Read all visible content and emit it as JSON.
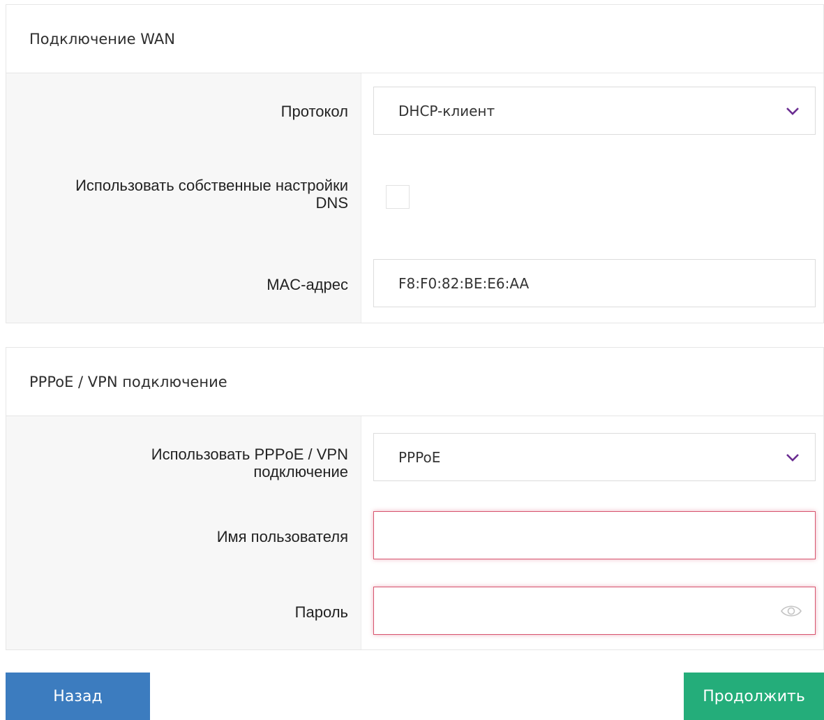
{
  "wan": {
    "title": "Подключение WAN",
    "protocol_label": "Протокол",
    "protocol_value": "DHCP-клиент",
    "dns_label_line1": "Использовать собственные настройки",
    "dns_label_line2": "DNS",
    "dns_checked": false,
    "mac_label": "MAC-адрес",
    "mac_value": "F8:F0:82:BE:E6:AA"
  },
  "pppoe": {
    "title": "PPPoE / VPN подключение",
    "use_label_line1": "Использовать PPPoE / VPN",
    "use_label_line2": "подключение",
    "use_value": "PPPoE",
    "username_label": "Имя пользователя",
    "username_value": "",
    "password_label": "Пароль",
    "password_value": ""
  },
  "buttons": {
    "back": "Назад",
    "next": "Продолжить"
  },
  "colors": {
    "accent_purple": "#6a2c91",
    "error": "#d8546e",
    "back_button": "#3c7cbf",
    "next_button": "#24ad7a"
  },
  "icons": {
    "dropdown": "chevron-down-icon",
    "password_toggle": "eye-icon"
  }
}
